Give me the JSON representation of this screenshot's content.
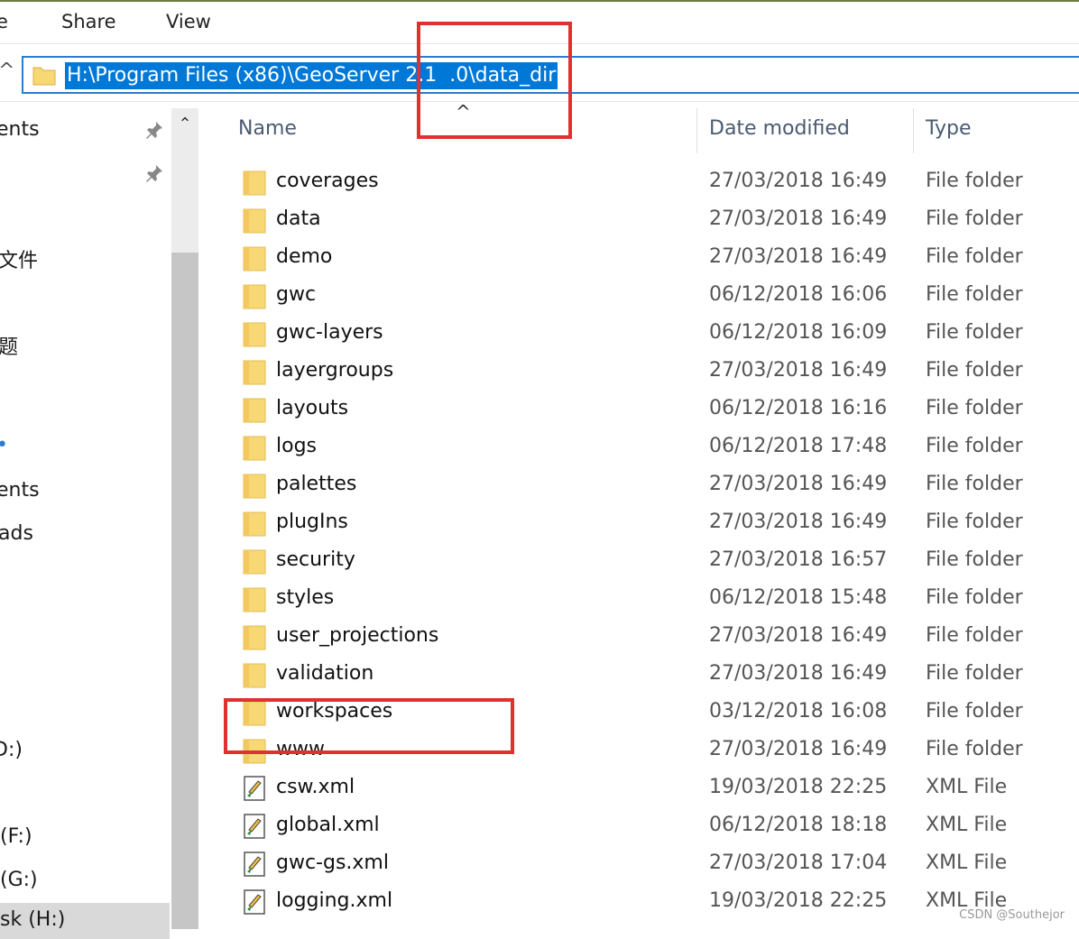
{
  "ribbon": {
    "tabs": [
      "e",
      "Share",
      "View"
    ]
  },
  "address_bar": {
    "path": "H:\\Program Files (x86)\\GeoServer 2.1  .0\\data_dir"
  },
  "icons": {
    "folder": "folder-icon",
    "xml": "xml-file-icon",
    "pin": "pin-icon",
    "up": "chevron-up-icon"
  },
  "nav_pane": {
    "items": [
      "ents",
      "文件",
      "题",
      "•",
      "ents",
      "ads",
      "D:)",
      "(F:)",
      "(G:)",
      "sk (H:)"
    ]
  },
  "columns": {
    "name": "Name",
    "date": "Date modified",
    "type": "Type"
  },
  "files": [
    {
      "name": "coverages",
      "date": "27/03/2018 16:49",
      "type": "File folder",
      "kind": "folder"
    },
    {
      "name": "data",
      "date": "27/03/2018 16:49",
      "type": "File folder",
      "kind": "folder"
    },
    {
      "name": "demo",
      "date": "27/03/2018 16:49",
      "type": "File folder",
      "kind": "folder"
    },
    {
      "name": "gwc",
      "date": "06/12/2018 16:06",
      "type": "File folder",
      "kind": "folder"
    },
    {
      "name": "gwc-layers",
      "date": "06/12/2018 16:09",
      "type": "File folder",
      "kind": "folder"
    },
    {
      "name": "layergroups",
      "date": "27/03/2018 16:49",
      "type": "File folder",
      "kind": "folder"
    },
    {
      "name": "layouts",
      "date": "06/12/2018 16:16",
      "type": "File folder",
      "kind": "folder"
    },
    {
      "name": "logs",
      "date": "06/12/2018 17:48",
      "type": "File folder",
      "kind": "folder"
    },
    {
      "name": "palettes",
      "date": "27/03/2018 16:49",
      "type": "File folder",
      "kind": "folder"
    },
    {
      "name": "plugIns",
      "date": "27/03/2018 16:49",
      "type": "File folder",
      "kind": "folder"
    },
    {
      "name": "security",
      "date": "27/03/2018 16:57",
      "type": "File folder",
      "kind": "folder"
    },
    {
      "name": "styles",
      "date": "06/12/2018 15:48",
      "type": "File folder",
      "kind": "folder"
    },
    {
      "name": "user_projections",
      "date": "27/03/2018 16:49",
      "type": "File folder",
      "kind": "folder"
    },
    {
      "name": "validation",
      "date": "27/03/2018 16:49",
      "type": "File folder",
      "kind": "folder"
    },
    {
      "name": "workspaces",
      "date": "03/12/2018 16:08",
      "type": "File folder",
      "kind": "folder"
    },
    {
      "name": "www",
      "date": "27/03/2018 16:49",
      "type": "File folder",
      "kind": "folder"
    },
    {
      "name": "csw.xml",
      "date": "19/03/2018 22:25",
      "type": "XML File",
      "kind": "xml"
    },
    {
      "name": "global.xml",
      "date": "06/12/2018 18:18",
      "type": "XML File",
      "kind": "xml"
    },
    {
      "name": "gwc-gs.xml",
      "date": "27/03/2018 17:04",
      "type": "XML File",
      "kind": "xml"
    },
    {
      "name": "logging.xml",
      "date": "19/03/2018 22:25",
      "type": "XML File",
      "kind": "xml"
    }
  ],
  "watermark": "CSDN @Southejor",
  "colors": {
    "selection": "#0078d7",
    "annotation": "#e03030",
    "folder": "#f8d775"
  }
}
